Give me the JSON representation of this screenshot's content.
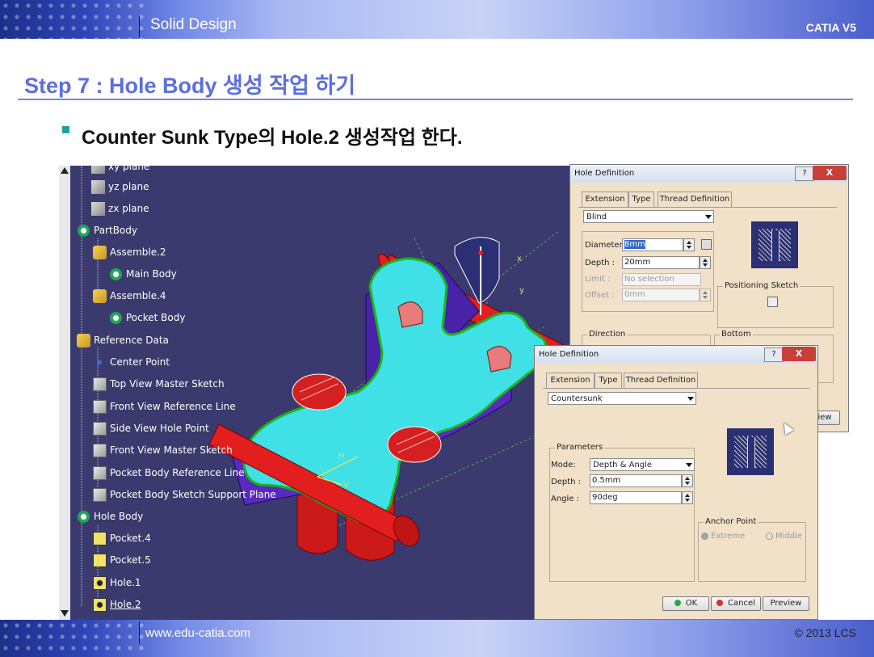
{
  "header": {
    "title": "Solid Design",
    "brand": "CATIA V5"
  },
  "step_title": "Step 7 : Hole Body 생성 작업 하기",
  "bullet": "Counter Sunk Type의 Hole.2 생성작업 한다.",
  "footer": {
    "url": "www.edu-catia.com",
    "copyright": "© 2013 LCS"
  },
  "tree": [
    {
      "label": "xy plane",
      "icon": "plane-icon"
    },
    {
      "label": "yz plane",
      "icon": "plane-icon"
    },
    {
      "label": "zx plane",
      "icon": "plane-icon"
    },
    {
      "label": "PartBody",
      "icon": "body-icon"
    },
    {
      "label": "Assemble.2",
      "icon": "assemble-icon"
    },
    {
      "label": "Main Body",
      "icon": "body-icon"
    },
    {
      "label": "Assemble.4",
      "icon": "assemble-icon"
    },
    {
      "label": "Pocket Body",
      "icon": "body-icon"
    },
    {
      "label": "Reference Data",
      "icon": "assemble-icon"
    },
    {
      "label": "Center Point",
      "icon": "point-icon"
    },
    {
      "label": "Top View Master Sketch",
      "icon": "sketch-icon"
    },
    {
      "label": "Front View Reference Line",
      "icon": "sketch-icon"
    },
    {
      "label": "Side View Hole Point",
      "icon": "sketch-icon"
    },
    {
      "label": "Front View Master Sketch",
      "icon": "sketch-icon"
    },
    {
      "label": "Pocket Body Reference Line",
      "icon": "sketch-icon"
    },
    {
      "label": "Pocket Body Sketch Support Plane",
      "icon": "sketch-icon"
    },
    {
      "label": "Hole Body",
      "icon": "body-icon"
    },
    {
      "label": "Pocket.4",
      "icon": "pocket-icon"
    },
    {
      "label": "Pocket.5",
      "icon": "pocket-icon"
    },
    {
      "label": "Hole.1",
      "icon": "hole-icon"
    },
    {
      "label": "Hole.2",
      "icon": "hole-icon"
    }
  ],
  "dialog1": {
    "title": "Hole Definition",
    "help": "?",
    "close": "X",
    "tabs": [
      "Extension",
      "Type",
      "Thread Definition"
    ],
    "extension_type": "Blind",
    "diameter_label": "Diameter :",
    "diameter_value": "8mm",
    "depth_label": "Depth :",
    "depth_value": "20mm",
    "limit_label": "Limit :",
    "limit_value": "No selection",
    "offset_label": "Offset :",
    "offset_value": "0mm",
    "positioning_sketch": "Positioning Sketch",
    "direction": "Direction",
    "bottom": "Bottom",
    "preview_partial": "iew"
  },
  "dialog2": {
    "title": "Hole Definition",
    "help": "?",
    "close": "X",
    "tabs": [
      "Extension",
      "Type",
      "Thread Definition"
    ],
    "hole_type": "Countersunk",
    "parameters": "Parameters",
    "mode_label": "Mode:",
    "mode_value": "Depth & Angle",
    "depth_label": "Depth :",
    "depth_value": "0.5mm",
    "angle_label": "Angle :",
    "angle_value": "90deg",
    "anchor_point": "Anchor Point",
    "anchor_options": [
      "Extreme",
      "Middle"
    ],
    "ok": "OK",
    "cancel": "Cancel",
    "preview": "Preview"
  },
  "viewport": {
    "axis_labels": [
      "x",
      "y",
      "H",
      "V"
    ]
  },
  "colors": {
    "accent": "#5b6fe0",
    "viewport_bg": "#3a3a6e",
    "dialog_bg": "#f1e1c8",
    "part_cyan": "#3fe0e6",
    "part_purple": "#5a2ac0",
    "pin_red": "#e21e1e"
  }
}
